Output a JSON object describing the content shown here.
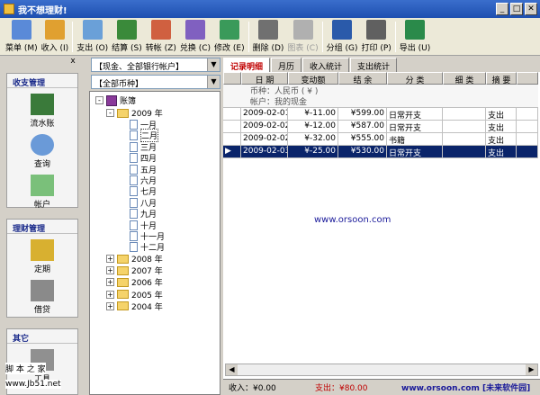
{
  "window": {
    "title": "我不想理财!"
  },
  "toolbar": {
    "items": [
      {
        "id": "menu",
        "label": "菜单 (M)",
        "color": "#5a8ad8"
      },
      {
        "id": "income",
        "label": "收入 (I)",
        "color": "#e0a030"
      },
      {
        "id": "expense",
        "label": "支出 (O)",
        "color": "#6aa0d8"
      },
      {
        "id": "settle",
        "label": "结算 (S)",
        "color": "#3a8a3a"
      },
      {
        "id": "transfer",
        "label": "转帐 (Z)",
        "color": "#d06040"
      },
      {
        "id": "exchange",
        "label": "兑换 (C)",
        "color": "#8060c0"
      },
      {
        "id": "edit",
        "label": "修改 (E)",
        "color": "#3a9a5a"
      },
      {
        "id": "delete",
        "label": "删除 (D)",
        "color": "#707070"
      },
      {
        "id": "chart",
        "label": "图表 (C)",
        "color": "#b0b0b0",
        "disabled": true
      },
      {
        "id": "group",
        "label": "分组 (G)",
        "color": "#2a5aaa"
      },
      {
        "id": "print",
        "label": "打印 (P)",
        "color": "#606060"
      },
      {
        "id": "export",
        "label": "导出 (U)",
        "color": "#2a8a4a"
      }
    ]
  },
  "left": {
    "close": "x",
    "groups": [
      {
        "title": "收支管理",
        "items": [
          "流水账",
          "查询",
          "帐户"
        ]
      },
      {
        "title": "理财管理",
        "items": [
          "定期",
          "借贷"
        ]
      },
      {
        "title": "其它",
        "items": [
          "工具"
        ]
      }
    ]
  },
  "filters": {
    "account": "【现金、全部银行帐户】",
    "currency": "【全部币种】"
  },
  "tree": {
    "root": "账簿",
    "year": "2009 年",
    "months": [
      "一月",
      "二月",
      "三月",
      "四月",
      "五月",
      "六月",
      "七月",
      "八月",
      "九月",
      "十月",
      "十一月",
      "十二月"
    ],
    "years": [
      "2008 年",
      "2007 年",
      "2006 年",
      "2005 年",
      "2004 年"
    ]
  },
  "tabs": [
    "记录明细",
    "月历",
    "收入统计",
    "支出统计"
  ],
  "grid": {
    "headers": [
      "日 期",
      "变动额",
      "结 余",
      "分 类",
      "细 类",
      "摘 要"
    ],
    "info": [
      "币种：人民币 ( ¥ )",
      "帐户：我的现金"
    ],
    "rows": [
      {
        "date": "2009-02-01",
        "change": "¥-11.00",
        "balance": "¥599.00",
        "cat": "日常开支",
        "sub": "",
        "note": "支出"
      },
      {
        "date": "2009-02-02",
        "change": "¥-12.00",
        "balance": "¥587.00",
        "cat": "日常开支",
        "sub": "",
        "note": "支出"
      },
      {
        "date": "2009-02-02",
        "change": "¥-32.00",
        "balance": "¥555.00",
        "cat": "书籍",
        "sub": "",
        "note": "支出"
      },
      {
        "date": "2009-02-03",
        "change": "¥-25.00",
        "balance": "¥530.00",
        "cat": "日常开支",
        "sub": "",
        "note": "支出"
      }
    ]
  },
  "watermark": "www.orsoon.com",
  "status": {
    "income": "收入：¥0.00",
    "expense": "支出：¥80.00",
    "site": "www.orsoon.com [未来软件园]"
  },
  "overlay": {
    "site_a": "脚 本 之 家",
    "site_b": "www.Jb51.net"
  }
}
